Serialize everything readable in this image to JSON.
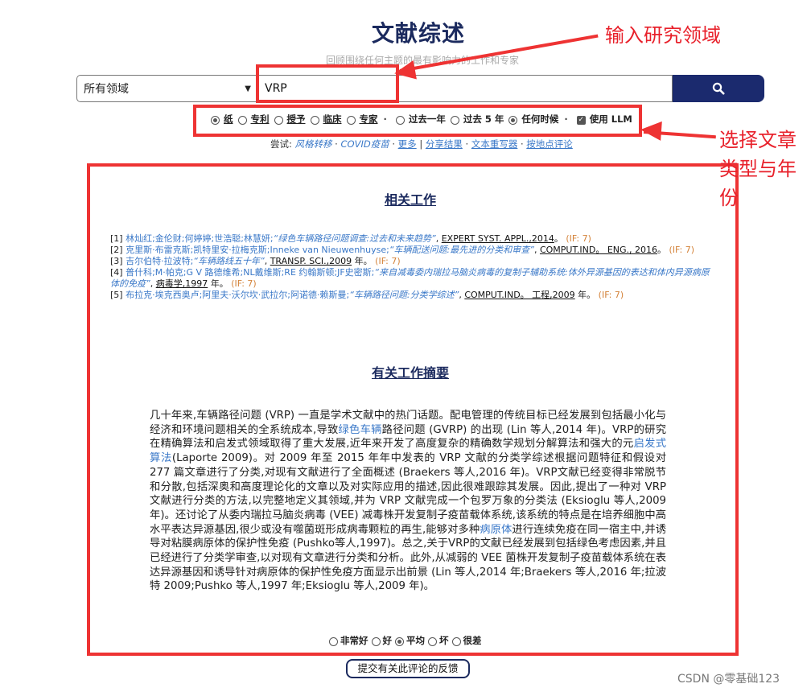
{
  "header": {
    "title": "文献综述",
    "subtitle": "回顾围绕任何主题的最有影响力的工作和专家"
  },
  "search": {
    "field_select": "所有领域",
    "query": "VRP",
    "button_icon": "search-icon"
  },
  "options": {
    "types": [
      {
        "label": "纸",
        "checked": true
      },
      {
        "label": "专利",
        "checked": false
      },
      {
        "label": "授予",
        "checked": false
      },
      {
        "label": "临床",
        "checked": false
      },
      {
        "label": "专家",
        "checked": false
      }
    ],
    "separator": "·",
    "time": [
      {
        "label": "过去一年",
        "checked": false
      },
      {
        "label": "过去 5 年",
        "checked": false
      },
      {
        "label": "任何时候",
        "checked": true
      }
    ],
    "llm": {
      "label": "使用 LLM",
      "checked": true
    }
  },
  "try": {
    "prefix": "尝试:",
    "ex1": "风格转移",
    "ex2": "COVID疫苗",
    "more": "更多",
    "share": "分享结果",
    "editor": "文本重写器",
    "location": "按地点评论"
  },
  "annotations": {
    "input": "输入研究领域",
    "type_year": "选择文章类型与年份"
  },
  "related": {
    "title": "相关工作",
    "refs": [
      {
        "num": "[1]",
        "authors": "林灿红;金伦财;何婷婷;世浩聪;林慧妍;",
        "title": "“绿色车辆路径问题调查:过去和未来趋势”",
        "journal": "EXPERT SYST. APPL.,2014",
        "tail": "。",
        "if": "(IF: 7)"
      },
      {
        "num": "[2]",
        "authors": "克里斯·布雷克斯;凯特里安·拉梅克斯;Inneke van Nieuwenhuyse;",
        "title": "“车辆配送问题:最先进的分类和审查”",
        "journal": "COMPUT.IND。 ENG.,  2016",
        "tail": "。",
        "if": "(IF: 7)"
      },
      {
        "num": "[3]",
        "authors": "吉尔伯特·拉波特;",
        "title": "“车辆路线五十年”",
        "journal": "TRANSP. SCI.,2009",
        "tail": " 年。",
        "if": "(IF: 7)"
      },
      {
        "num": "[4]",
        "authors": "普什科;M·帕克;G V 路德维希;NL戴维斯;RE 约翰斯顿;JF史密斯;",
        "title": "“来自减毒委内瑞拉马脑炎病毒的复制子辅助系统:体外异源基因的表达和体内异源病原体的免疫”",
        "journal": "病毒学,1997",
        "tail": " 年。",
        "if": "(IF: 7)"
      },
      {
        "num": "[5]",
        "authors": "布拉克·埃克西奥卢;阿里夫·沃尔坎·武拉尔;阿诺德·赖斯曼;",
        "title": "“车辆路径问题:分类学综述”",
        "journal": "COMPUT.IND。 工程,2009",
        "tail": " 年。",
        "if": "(IF: 7)"
      }
    ]
  },
  "summary": {
    "title": "有关工作摘要",
    "p1": "几十年来,车辆路径问题 (VRP) 一直是学术文献中的热门话题。配电管理的传统目标已经发展到包括最小化与经济和环境问题相关的全系统成本,导致",
    "hl1": "绿色车辆",
    "p2": "路径问题 (GVRP) 的出现 (Lin 等人,2014 年)。VRP的研究在精确算法和启发式领域取得了重大发展,近年来开发了高度复杂的精确数学规划分解算法和强大的元",
    "hl2": "启发式算法",
    "p3": "(Laporte 2009)。对 2009 年至 2015 年年中发表的 VRP 文献的分类学综述根据问题特征和假设对 277 篇文章进行了分类,对现有文献进行了全面概述 (Braekers 等人,2016 年)。VRP文献已经变得非常脱节和分散,包括深奥和高度理论化的文章以及对实际应用的描述,因此很难跟踪其发展。因此,提出了一种对 VRP 文献进行分类的方法,以完整地定义其领域,并为 VRP 文献完成一个包罗万象的分类法 (Eksioglu 等人,2009 年)。还讨论了从委内瑞拉马脑炎病毒 (VEE) 减毒株开发复制子疫苗载体系统,该系统的特点是在培养细胞中高水平表达异源基因,很少或没有噬菌斑形成病毒颗粒的再生,能够对多种",
    "hl3": "病原体",
    "p4": "进行连续免疫在同一宿主中,并诱导对粘膜病原体的保护性免疫 (Pushko等人,1997)。总之,关于VRP的文献已经发展到包括绿色考虑因素,并且已经进行了分类学审查,以对现有文章进行分类和分析。此外,从减弱的 VEE 菌株开发复制子疫苗载体系统在表达异源基因和诱导针对病原体的保护性免疫方面显示出前景 (Lin 等人,2014 年;Braekers 等人,2016 年;拉波特 2009;Pushko 等人,1997 年;Eksioglu 等人,2009 年)。"
  },
  "rating": {
    "options": [
      {
        "label": "非常好",
        "checked": false
      },
      {
        "label": "好",
        "checked": false
      },
      {
        "label": "平均",
        "checked": true
      },
      {
        "label": "坏",
        "checked": false
      },
      {
        "label": "很差",
        "checked": false
      }
    ]
  },
  "feedback": {
    "label": "提交有关此评论的反馈"
  },
  "watermark": "CSDN @零基础123",
  "colors": {
    "accent": "#1b2a5e",
    "annotation": "#ee3333",
    "link": "#3a78c8",
    "if_value": "#d4833a"
  }
}
